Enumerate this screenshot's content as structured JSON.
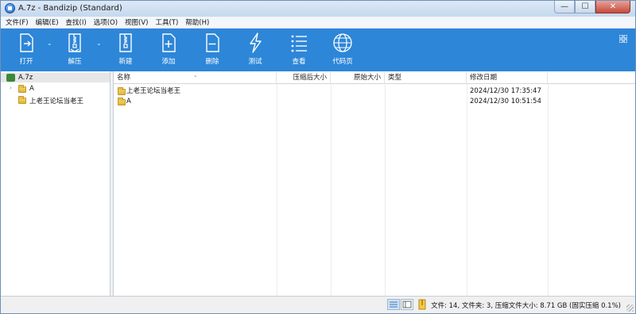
{
  "window": {
    "title": "A.7z - Bandizip (Standard)",
    "minimize": "—",
    "maximize": "☐",
    "close": "✕"
  },
  "menu": [
    "文件(F)",
    "编辑(E)",
    "查找(I)",
    "选项(O)",
    "视图(V)",
    "工具(T)",
    "帮助(H)"
  ],
  "toolbar": {
    "open": "打开",
    "extract": "解压",
    "new": "新建",
    "add": "添加",
    "delete": "删除",
    "test": "测试",
    "view": "查看",
    "codepage": "代码页",
    "dropdown_glyph": "⌄"
  },
  "tree": {
    "root": "A.7z",
    "items": [
      {
        "label": "A",
        "expander": "›"
      },
      {
        "label": "上老王论坛当老王"
      }
    ]
  },
  "columns": [
    "名称",
    "压缩后大小",
    "原始大小",
    "类型",
    "修改日期"
  ],
  "sort_caret": "⌄",
  "rows": [
    {
      "name": "上老王论坛当老王",
      "packed": "",
      "size": "",
      "type": "",
      "modified": "2024/12/30 17:35:47"
    },
    {
      "name": "A",
      "packed": "",
      "size": "",
      "type": "",
      "modified": "2024/12/30 10:51:54"
    }
  ],
  "status": {
    "summary": "文件: 14, 文件夹: 3, 压缩文件大小: 8.71 GB (固实压缩 0.1%)"
  },
  "colors": {
    "toolbar": "#2d86d8",
    "titlebar": "#c5d8ee",
    "folder": "#e0b33a"
  },
  "icons": [
    "open-icon",
    "extract-icon",
    "new-icon",
    "add-icon",
    "delete-icon",
    "test-icon",
    "view-icon",
    "codepage-icon",
    "folder-icon",
    "archive-icon"
  ]
}
